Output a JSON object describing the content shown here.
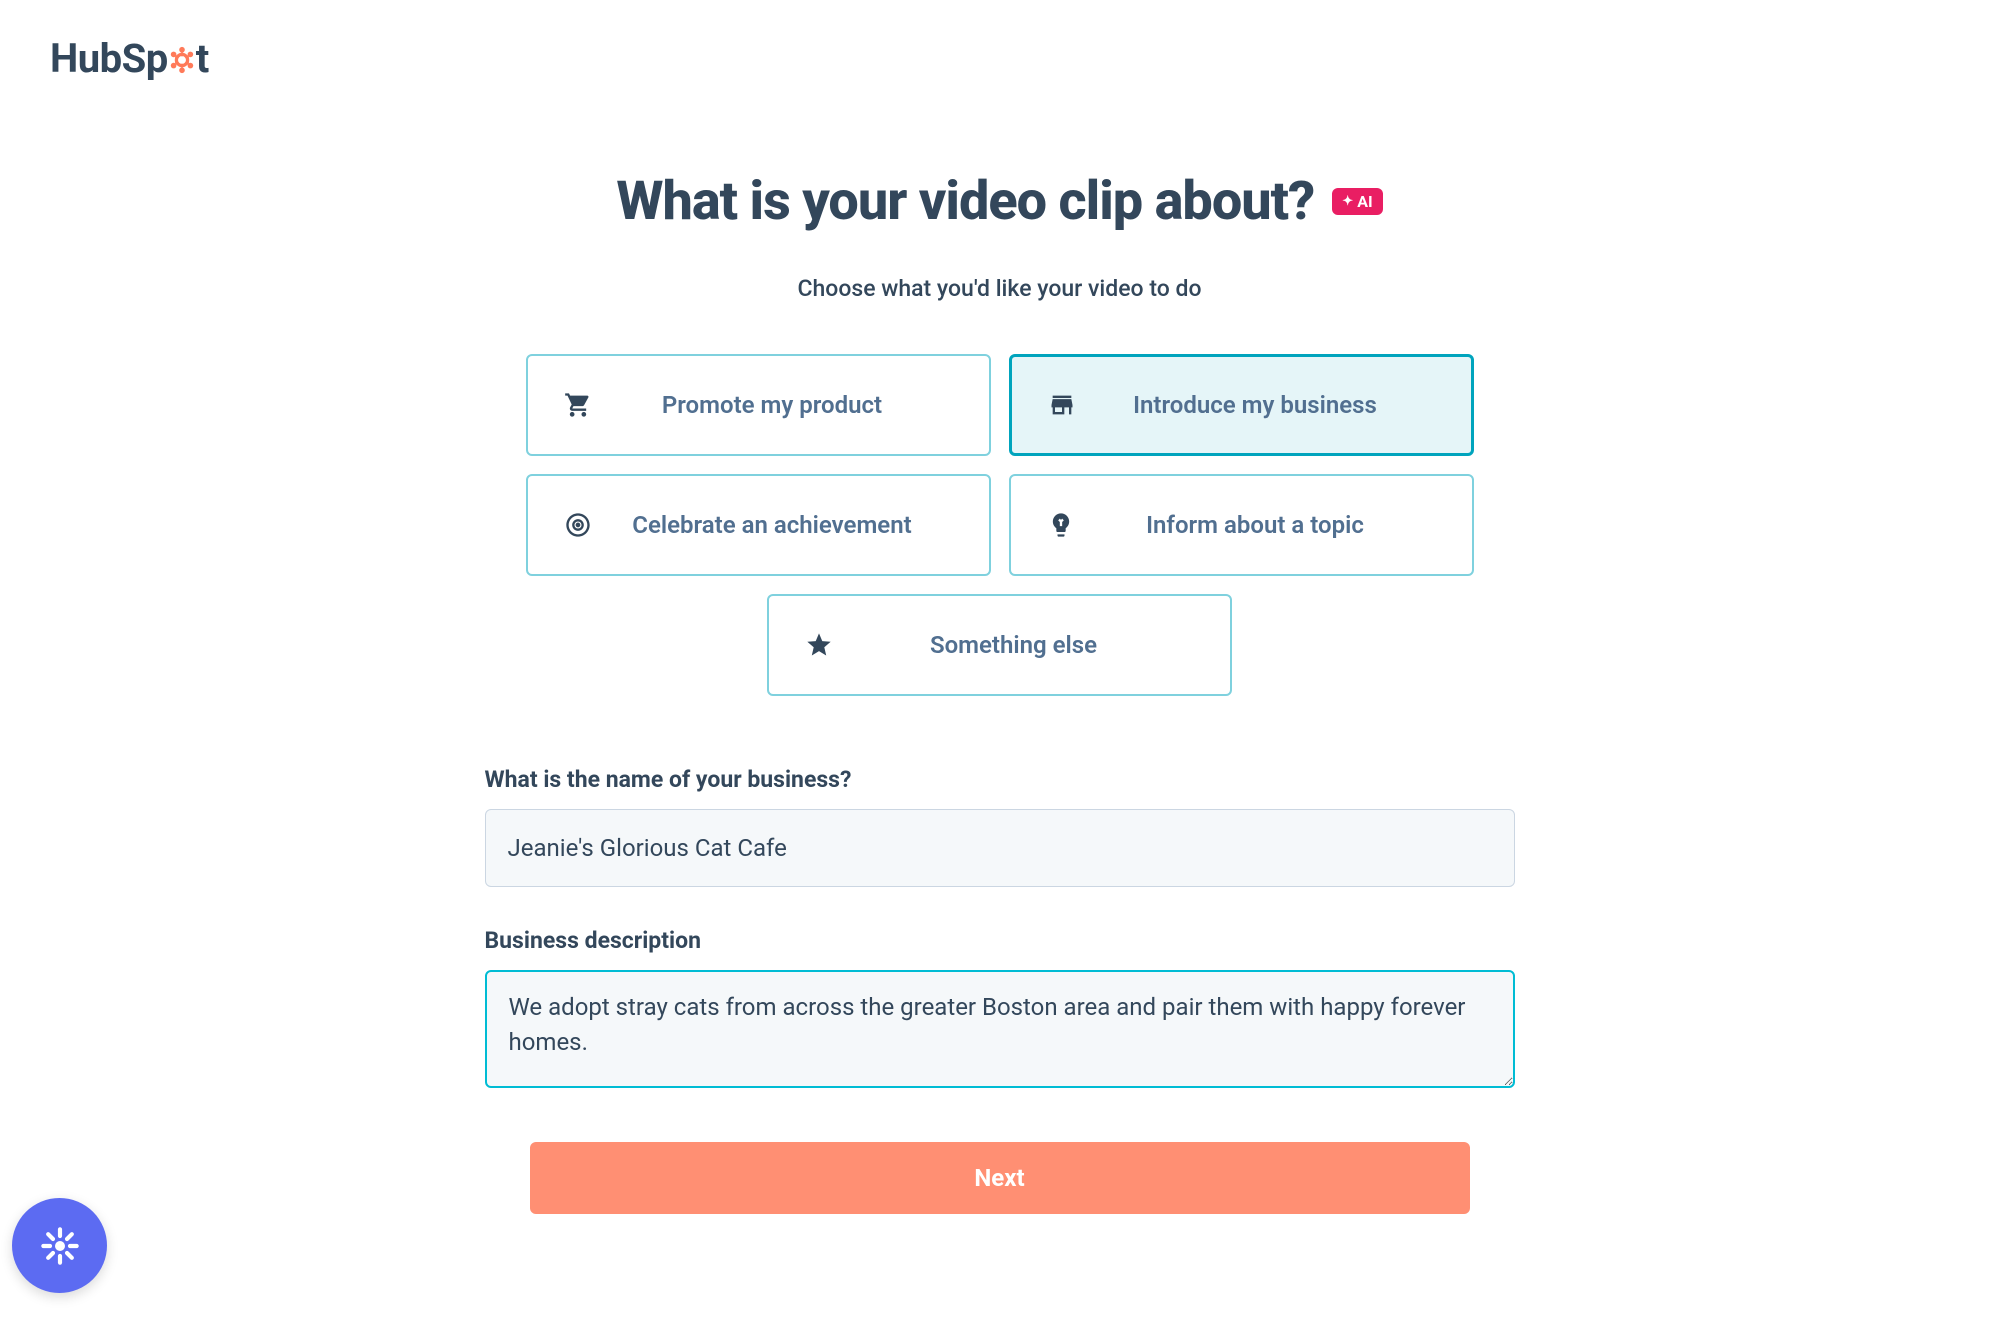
{
  "logo": {
    "text_before": "HubSp",
    "text_after": "t"
  },
  "header": {
    "title": "What is your video clip about?",
    "ai_badge": "AI",
    "subtitle": "Choose what you'd like your video to do"
  },
  "options": {
    "promote_product": "Promote my product",
    "introduce_business": "Introduce my business",
    "celebrate_achievement": "Celebrate an achievement",
    "inform_topic": "Inform about a topic",
    "something_else": "Something else",
    "selected": "introduce_business"
  },
  "form": {
    "business_name_label": "What is the name of your business?",
    "business_name_value": "Jeanie's Glorious Cat Cafe",
    "business_description_label": "Business description",
    "business_description_value": "We adopt stray cats from across the greater Boston area and pair them with happy forever homes."
  },
  "next_button": "Next"
}
